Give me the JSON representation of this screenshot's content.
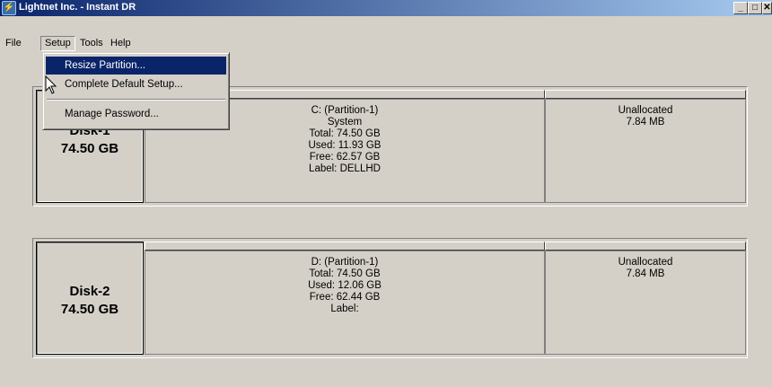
{
  "window": {
    "title": "Lightnet Inc. - Instant DR",
    "icon": "app-icon",
    "controls": {
      "minimize": "_",
      "maximize": "□",
      "close": "✕"
    }
  },
  "menubar": {
    "items": [
      "File",
      "Setup",
      "Tools",
      "Help"
    ],
    "open_menu": "Setup"
  },
  "setup_menu": {
    "items": [
      "Resize Partition...",
      "Complete Default Setup...",
      "Manage Password..."
    ],
    "highlighted": "Resize Partition..."
  },
  "disks": [
    {
      "name": "Disk-1",
      "size": "74.50 GB",
      "partitions": [
        {
          "lines": [
            "C: (Partition-1)",
            "System",
            "Total: 74.50 GB",
            "Used: 11.93 GB",
            "Free: 62.57 GB",
            "Label: DELLHD"
          ]
        },
        {
          "lines": [
            "Unallocated",
            "7.84 MB"
          ]
        }
      ]
    },
    {
      "name": "Disk-2",
      "size": "74.50 GB",
      "partitions": [
        {
          "lines": [
            "D: (Partition-1)",
            "Total: 74.50 GB",
            "Used: 12.06 GB",
            "Free: 62.44 GB",
            "Label:"
          ]
        },
        {
          "lines": [
            "Unallocated",
            "7.84 MB"
          ]
        }
      ]
    }
  ],
  "colors": {
    "title_bar": "#0a246a",
    "menu_highlight": "#0a246a",
    "face": "#d4d0c8"
  }
}
